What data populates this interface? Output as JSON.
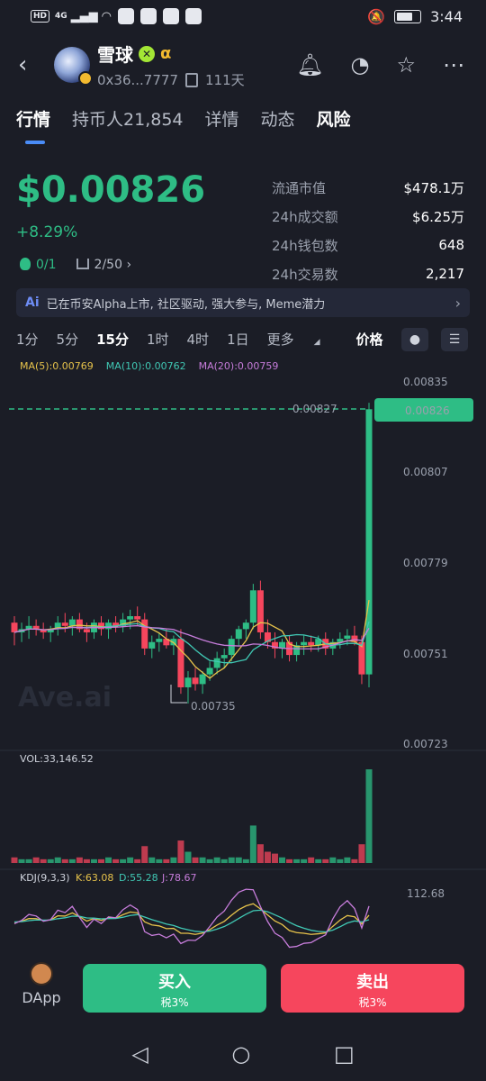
{
  "status_bar": {
    "badge": "HD",
    "network": "4G",
    "time": "3:44"
  },
  "header": {
    "title": "雪球",
    "verify_glyph": "✕",
    "alpha_glyph": "α",
    "address": "0x36...7777",
    "age": "111天"
  },
  "tabs": [
    {
      "label": "行情",
      "active": true
    },
    {
      "label": "持币人21,854"
    },
    {
      "label": "详情"
    },
    {
      "label": "动态"
    },
    {
      "label": "风险"
    }
  ],
  "price": {
    "value": "$0.00826",
    "change": "+8.29%",
    "stat_a": "0/1",
    "stat_b": "2/50"
  },
  "stats": [
    {
      "label": "流通市值",
      "value": "$478.1万"
    },
    {
      "label": "24h成交额",
      "value": "$6.25万"
    },
    {
      "label": "24h钱包数",
      "value": "648"
    },
    {
      "label": "24h交易数",
      "value": "2,217"
    }
  ],
  "banner": {
    "tag": "Ai",
    "text": "已在币安Alpha上市, 社区驱动, 强大参与, Meme潜力"
  },
  "intervals": [
    "1分",
    "5分",
    "15分",
    "1时",
    "4时",
    "1日",
    "更多"
  ],
  "selected_interval": "15分",
  "price_mode": "价格",
  "ma_legend": [
    {
      "label": "MA(5):0.00769",
      "color": "#e7c34b"
    },
    {
      "label": "MA(10):0.00762",
      "color": "#40c8b4"
    },
    {
      "label": "MA(20):0.00759",
      "color": "#c77ddb"
    }
  ],
  "colors": {
    "up": "#2ebd85",
    "down": "#f6465d",
    "accent": "#4a8cf7"
  },
  "chart_data": {
    "type": "candlestick",
    "price_axis_ticks": [
      "0.00835",
      "0.00807",
      "0.00779",
      "0.00751",
      "0.00723"
    ],
    "ylim": [
      0.00723,
      0.00835
    ],
    "current_price_label": "0.00826",
    "high_marker": "0.00827",
    "low_marker": "0.00735",
    "watermark": "Ave.ai",
    "vol_label": "VOL:33,146.52",
    "kdj": {
      "label": "KDJ(9,3,3)",
      "k": "K:63.08",
      "d": "D:55.28",
      "j": "J:78.67",
      "axis_top": "112.68"
    },
    "candles": [
      [
        0.0076,
        0.00762,
        0.00753,
        0.00757
      ],
      [
        0.00757,
        0.0076,
        0.00754,
        0.00758
      ],
      [
        0.00758,
        0.00762,
        0.00755,
        0.00759
      ],
      [
        0.00759,
        0.00761,
        0.00756,
        0.00758
      ],
      [
        0.00758,
        0.0076,
        0.00755,
        0.00757
      ],
      [
        0.00757,
        0.00759,
        0.00754,
        0.00758
      ],
      [
        0.00758,
        0.00762,
        0.00756,
        0.0076
      ],
      [
        0.0076,
        0.00763,
        0.00757,
        0.00759
      ],
      [
        0.00759,
        0.00762,
        0.00756,
        0.00761
      ],
      [
        0.00761,
        0.00763,
        0.00757,
        0.00758
      ],
      [
        0.00758,
        0.0076,
        0.00754,
        0.00757
      ],
      [
        0.00757,
        0.00761,
        0.00755,
        0.0076
      ],
      [
        0.0076,
        0.00762,
        0.00756,
        0.00758
      ],
      [
        0.00758,
        0.00761,
        0.00755,
        0.0076
      ],
      [
        0.0076,
        0.00762,
        0.00757,
        0.00759
      ],
      [
        0.00759,
        0.00763,
        0.00757,
        0.00761
      ],
      [
        0.00761,
        0.00764,
        0.00758,
        0.00762
      ],
      [
        0.00762,
        0.00765,
        0.00759,
        0.00761
      ],
      [
        0.00761,
        0.00763,
        0.0075,
        0.00752
      ],
      [
        0.00752,
        0.00756,
        0.00749,
        0.00754
      ],
      [
        0.00754,
        0.00757,
        0.00751,
        0.00755
      ],
      [
        0.00755,
        0.00758,
        0.00752,
        0.00753
      ],
      [
        0.00753,
        0.00756,
        0.0075,
        0.00755
      ],
      [
        0.00755,
        0.00758,
        0.00738,
        0.0074
      ],
      [
        0.0074,
        0.00745,
        0.00735,
        0.00743
      ],
      [
        0.00743,
        0.00746,
        0.00739,
        0.00741
      ],
      [
        0.00741,
        0.00745,
        0.00738,
        0.00744
      ],
      [
        0.00744,
        0.00748,
        0.00742,
        0.00746
      ],
      [
        0.00746,
        0.00751,
        0.00744,
        0.00749
      ],
      [
        0.00749,
        0.00752,
        0.00746,
        0.0075
      ],
      [
        0.0075,
        0.00756,
        0.00748,
        0.00755
      ],
      [
        0.00755,
        0.00759,
        0.00753,
        0.00758
      ],
      [
        0.00758,
        0.00761,
        0.00755,
        0.0076
      ],
      [
        0.0076,
        0.00772,
        0.00758,
        0.0077
      ],
      [
        0.0077,
        0.00773,
        0.00755,
        0.00757
      ],
      [
        0.00757,
        0.00761,
        0.00752,
        0.00754
      ],
      [
        0.00754,
        0.00757,
        0.00749,
        0.00752
      ],
      [
        0.00752,
        0.00755,
        0.00749,
        0.00754
      ],
      [
        0.00754,
        0.00756,
        0.00748,
        0.0075
      ],
      [
        0.0075,
        0.00754,
        0.00748,
        0.00753
      ],
      [
        0.00753,
        0.00756,
        0.0075,
        0.00754
      ],
      [
        0.00754,
        0.00756,
        0.00751,
        0.00753
      ],
      [
        0.00753,
        0.00756,
        0.00751,
        0.00755
      ],
      [
        0.00755,
        0.00757,
        0.0075,
        0.00752
      ],
      [
        0.00752,
        0.00755,
        0.0075,
        0.00754
      ],
      [
        0.00754,
        0.00757,
        0.00752,
        0.00755
      ],
      [
        0.00755,
        0.00758,
        0.00753,
        0.00756
      ],
      [
        0.00756,
        0.00759,
        0.00753,
        0.00754
      ],
      [
        0.00754,
        0.00756,
        0.00741,
        0.00744
      ],
      [
        0.00744,
        0.00828,
        0.0074,
        0.00826
      ]
    ],
    "volumes": [
      3,
      2,
      2,
      3,
      2,
      2,
      3,
      2,
      2,
      3,
      2,
      2,
      2,
      3,
      2,
      2,
      3,
      2,
      9,
      3,
      2,
      2,
      3,
      12,
      6,
      3,
      3,
      2,
      3,
      2,
      3,
      3,
      2,
      20,
      10,
      6,
      5,
      3,
      2,
      2,
      2,
      3,
      2,
      2,
      3,
      2,
      3,
      2,
      10,
      50
    ]
  },
  "actions": {
    "dapp": "DApp",
    "buy": "买入",
    "buy_tax": "税3%",
    "sell": "卖出",
    "sell_tax": "税3%"
  }
}
